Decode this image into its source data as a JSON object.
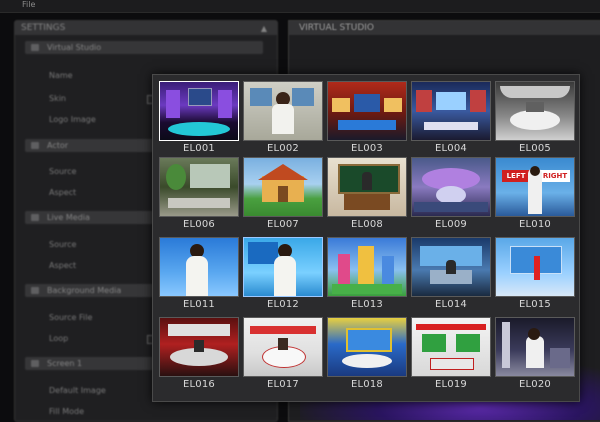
{
  "menubar": {
    "file": "File"
  },
  "settings_panel": {
    "title": "SETTINGS",
    "sections": [
      {
        "title": "Virtual Studio",
        "rows": [
          {
            "label": "Name",
            "value": ""
          },
          {
            "label": "Skin",
            "value": ""
          },
          {
            "label": "Logo Image",
            "value": ""
          }
        ]
      },
      {
        "title": "Actor",
        "rows": [
          {
            "label": "Source",
            "value": ""
          },
          {
            "label": "Aspect",
            "value": ""
          }
        ]
      },
      {
        "title": "Live Media",
        "rows": [
          {
            "label": "Source",
            "value": ""
          },
          {
            "label": "Aspect",
            "value": ""
          }
        ]
      },
      {
        "title": "Background Media",
        "rows": [
          {
            "label": "Source File",
            "value": ""
          },
          {
            "label": "Loop",
            "value": ""
          }
        ]
      },
      {
        "title": "Screen 1",
        "rows": [
          {
            "label": "Default Image",
            "value": ""
          },
          {
            "label": "Fill Mode",
            "value": ""
          }
        ]
      }
    ]
  },
  "studio_panel": {
    "title": "VIRTUAL STUDIO"
  },
  "picker": {
    "items": [
      {
        "label": "EL001",
        "state": "selected"
      },
      {
        "label": "EL002"
      },
      {
        "label": "EL003"
      },
      {
        "label": "EL004"
      },
      {
        "label": "EL005"
      },
      {
        "label": "EL006"
      },
      {
        "label": "EL007"
      },
      {
        "label": "EL008"
      },
      {
        "label": "EL009"
      },
      {
        "label": "EL010"
      },
      {
        "label": "EL011"
      },
      {
        "label": "EL012",
        "state": "hover"
      },
      {
        "label": "EL013"
      },
      {
        "label": "EL014"
      },
      {
        "label": "EL015"
      },
      {
        "label": "EL016"
      },
      {
        "label": "EL017"
      },
      {
        "label": "EL018"
      },
      {
        "label": "EL019"
      },
      {
        "label": "EL020"
      }
    ],
    "thumb_label_texts": {
      "el010_left": "LEFT",
      "el010_right": "RIGHT"
    }
  }
}
